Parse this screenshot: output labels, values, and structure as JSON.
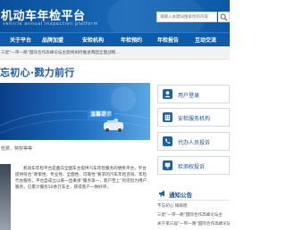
{
  "header": {
    "title": "机动车年检平台",
    "subtitle": "vehicle annual inspection platform",
    "search_placeholder": "请输入关键词搜索你的内容"
  },
  "nav": {
    "items": [
      "关于平台",
      "品牌加盟",
      "安检机构",
      "年检预约",
      "年检报告",
      "互动交流"
    ]
  },
  "notice_bar": {
    "text": "三星\"一带一路\"国际合作高峰论坛主题将如何推进两国全面战略..."
  },
  "slogan": "忘初心·戮力前行",
  "banner": {
    "badge": "温馨提示",
    "caption": "检费、特权等等"
  },
  "quick_links": [
    {
      "label": "用户登录",
      "icon": "user-icon"
    },
    {
      "label": "安检服务机构",
      "icon": "building-icon"
    },
    {
      "label": "代办人员投诉",
      "icon": "phone-icon"
    },
    {
      "label": "检测权投诉",
      "icon": "device-icon"
    }
  ],
  "intro": {
    "text": "机动车年检平台是面向全国车主提供汽车年检服务的便民平台，平台提供符合“政策性、专业性、全面性、可靠性”要求的汽车年检咨询、年检代办服务，平台自成立以来一直秉承“服务第一，客户至上”的宗旨为用户服务，已累计服务50余万车主，获得客户一致好评。"
  },
  "news": {
    "title": "通知公告",
    "items": [
      "不忘初心 铸辉煌",
      "三星\"一带一路\"国际合作高峰论坛主",
      "关于第三届\"一带一路\"国际合作高峰论坛"
    ]
  },
  "colors": {
    "header_blue": "#0a4f9a",
    "nav_blue": "#0d5bab",
    "accent_text": "#1d4f8c",
    "slogan_blue": "#1c5ea8"
  }
}
